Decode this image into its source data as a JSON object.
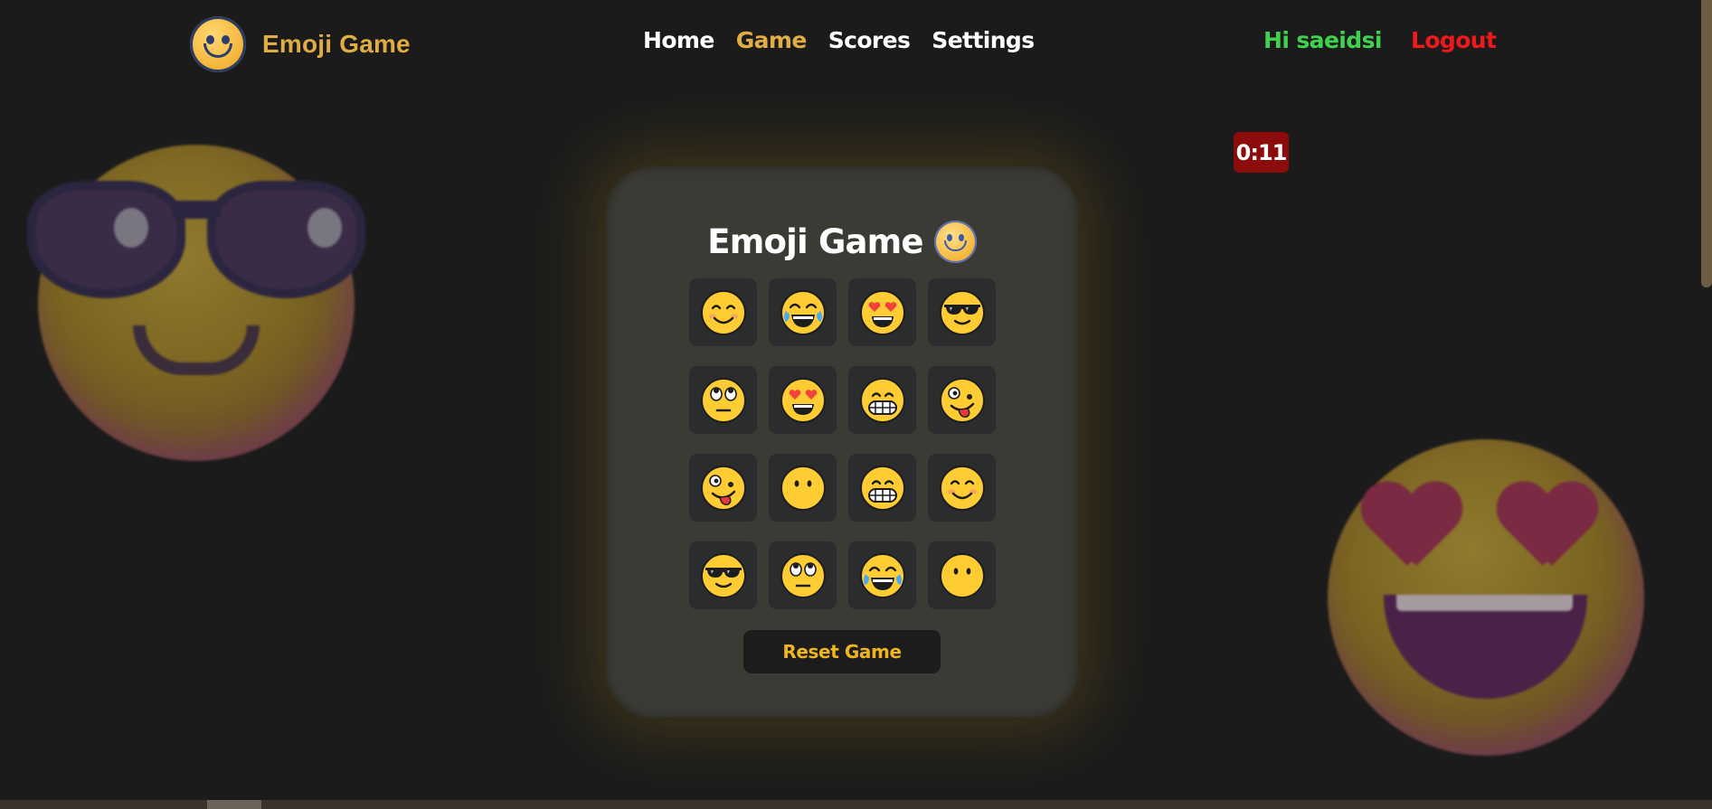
{
  "nav": {
    "brand": "Emoji Game",
    "links": [
      {
        "label": "Home",
        "active": false
      },
      {
        "label": "Game",
        "active": true
      },
      {
        "label": "Scores",
        "active": false
      },
      {
        "label": "Settings",
        "active": false
      }
    ],
    "greeting": "Hi saeidsi",
    "logout": "Logout"
  },
  "timer": "0:11",
  "game": {
    "title": "Emoji Game",
    "title_icon": "smiley-icon",
    "reset_label": "Reset Game",
    "board": [
      [
        "smiling-face",
        "tears-of-joy",
        "heart-eyes",
        "sunglasses"
      ],
      [
        "eye-roll",
        "heart-eyes",
        "grimacing-grin",
        "zany-face"
      ],
      [
        "zany-face",
        "neutral-face",
        "grimacing-grin",
        "smiling-face"
      ],
      [
        "sunglasses",
        "eye-roll",
        "tears-of-joy",
        "neutral-face"
      ]
    ]
  },
  "colors": {
    "background": "#1b1b1b",
    "accent": "#e0ad42",
    "greeting": "#3fd24e",
    "logout": "#f01818",
    "timer_bg": "#8c0c0c",
    "card_bg": "#3b3a34",
    "tile_bg": "#2b2c2d",
    "reset_text": "#f0b51e"
  },
  "decor": {
    "left_bg_emoji": "sunglasses-face",
    "right_bg_emoji": "heart-eyes-face"
  }
}
